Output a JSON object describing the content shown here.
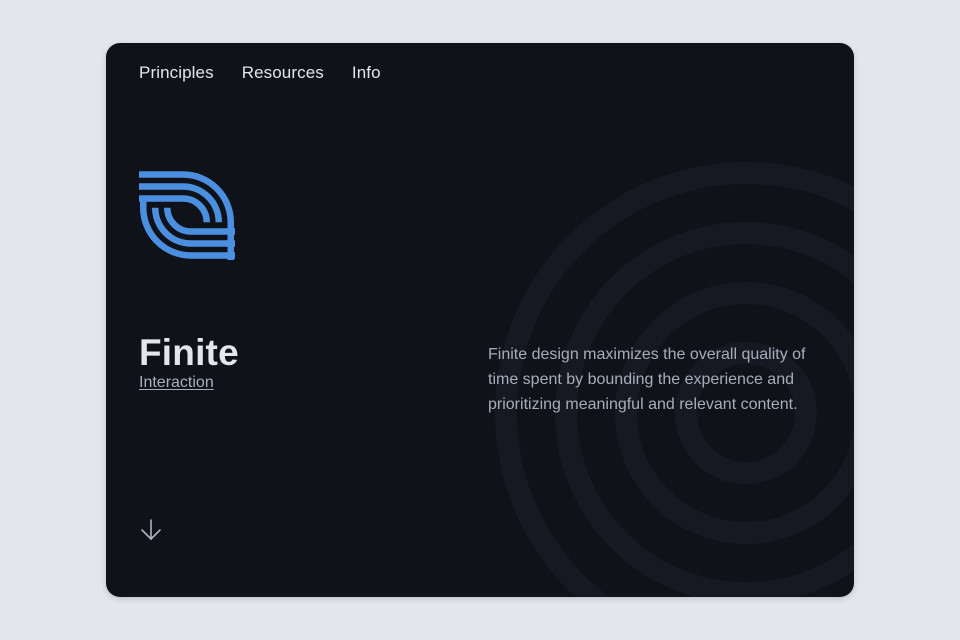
{
  "nav": {
    "items": [
      {
        "label": "Principles"
      },
      {
        "label": "Resources"
      },
      {
        "label": "Info"
      }
    ]
  },
  "hero": {
    "title": "Finite",
    "subtitle_link": "Interaction",
    "description": "Finite design maximizes the overall quality of time spent by bounding the experience and prioritizing meaningful and relevant content.",
    "logo_icon": "finite-logo-icon",
    "scroll_icon": "arrow-down-icon"
  },
  "colors": {
    "page_background": "#e3e7ec",
    "card_background": "#10121a",
    "accent": "#4a8fe0",
    "text_primary": "#e4e6ec",
    "text_secondary": "#a7adbb"
  }
}
